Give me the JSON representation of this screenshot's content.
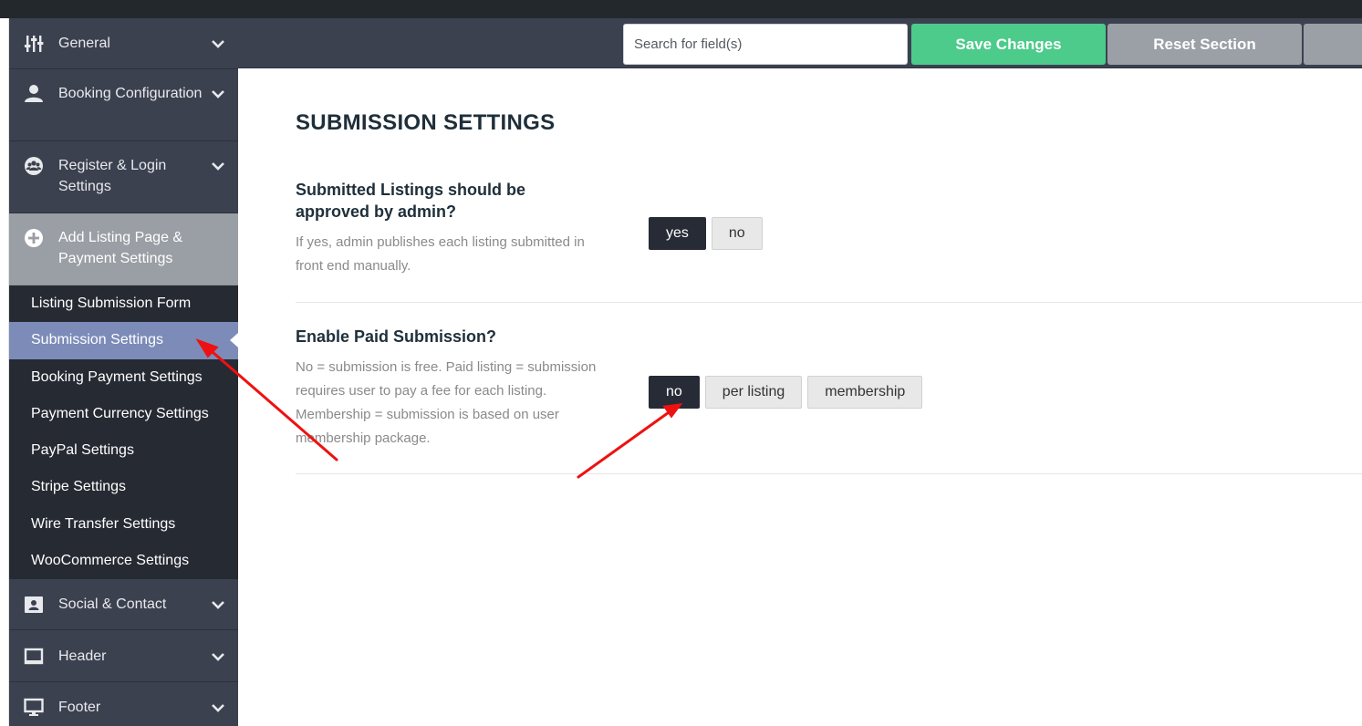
{
  "sidebar": {
    "items": [
      {
        "label": "General",
        "icon": "sliders-icon"
      },
      {
        "label": "Booking Configuration",
        "icon": "user-icon"
      },
      {
        "label": "Register & Login Settings",
        "icon": "users-circle-icon"
      },
      {
        "label": "Add Listing Page & Payment Settings",
        "icon": "plus-circle-icon"
      }
    ],
    "submenu": [
      "Listing Submission Form",
      "Submission Settings",
      "Booking Payment Settings",
      "Payment Currency Settings",
      "PayPal Settings",
      "Stripe Settings",
      "Wire Transfer Settings",
      "WooCommerce Settings"
    ],
    "items_after": [
      {
        "label": "Social & Contact",
        "icon": "contact-card-icon"
      },
      {
        "label": "Header",
        "icon": "window-icon"
      },
      {
        "label": "Footer",
        "icon": "monitor-icon"
      }
    ]
  },
  "header": {
    "search_placeholder": "Search for field(s)",
    "save_label": "Save Changes",
    "reset_label": "Reset Section"
  },
  "main": {
    "title": "SUBMISSION SETTINGS",
    "fields": [
      {
        "label": "Submitted Listings should be approved by admin?",
        "description": "If yes, admin publishes each listing submitted in front end manually.",
        "options": [
          "yes",
          "no"
        ],
        "selected": "yes"
      },
      {
        "label": "Enable Paid Submission?",
        "description": "No = submission is free. Paid listing = submission requires user to pay a fee for each listing. Membership = submission is based on user membership package.",
        "options": [
          "no",
          "per listing",
          "membership"
        ],
        "selected": "no"
      }
    ]
  },
  "colors": {
    "save": "#4ccb8b",
    "reset": "#9ba0a7",
    "sidebar": "#3c4150",
    "submenu": "#262a33",
    "selected_submenu": "#7c8bb8",
    "annotation_arrow": "#ee1111"
  }
}
